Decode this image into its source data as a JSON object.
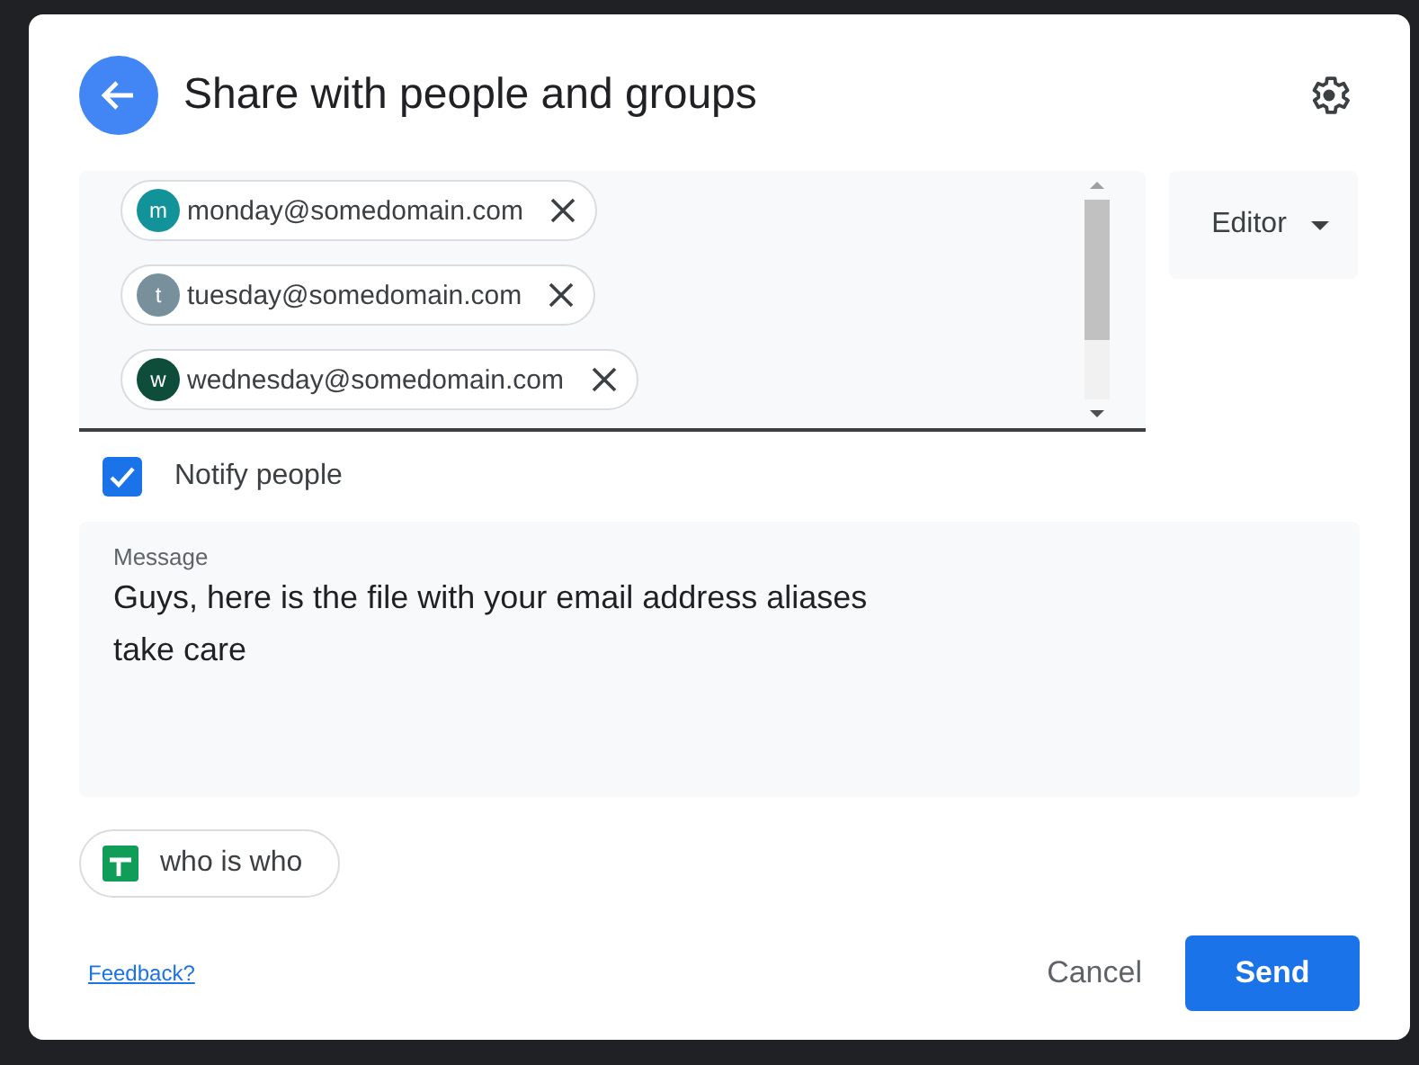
{
  "dialog": {
    "title": "Share with people and groups"
  },
  "recipients": [
    {
      "initial": "m",
      "email": "monday@somedomain.com",
      "color": "#12939a"
    },
    {
      "initial": "t",
      "email": "tuesday@somedomain.com",
      "color": "#78909c"
    },
    {
      "initial": "w",
      "email": "wednesday@somedomain.com",
      "color": "#0d4d3a"
    }
  ],
  "role": {
    "value": "Editor"
  },
  "notify": {
    "label": "Notify people",
    "checked": true
  },
  "message": {
    "label": "Message",
    "value": "Guys, here is the file with your email address aliases\ntake care"
  },
  "attachment": {
    "name": "who is who"
  },
  "footer": {
    "feedback": "Feedback?",
    "cancel": "Cancel",
    "send": "Send"
  }
}
